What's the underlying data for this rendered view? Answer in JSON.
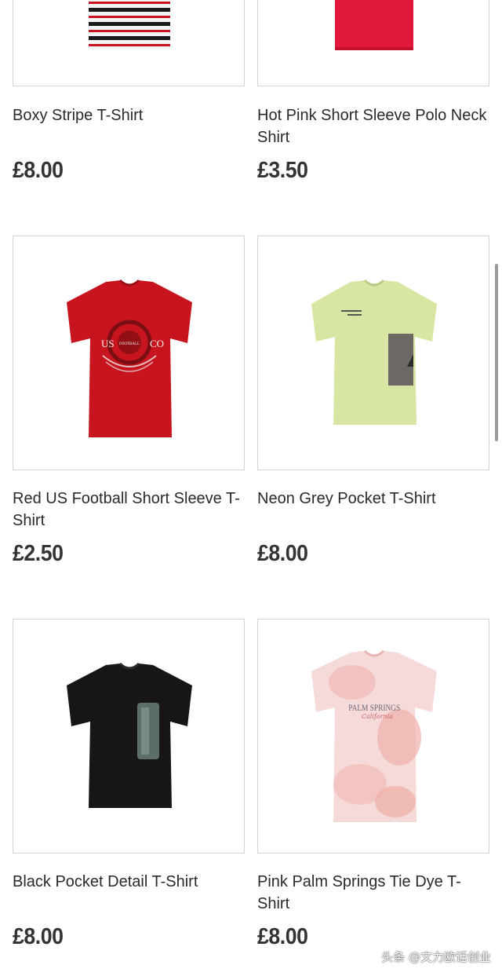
{
  "products": [
    {
      "name": "Boxy Stripe T-Shirt",
      "price": "£8.00"
    },
    {
      "name": "Hot Pink Short Sleeve Polo Neck Shirt",
      "price": "£3.50"
    },
    {
      "name": "Red US Football Short Sleeve T-Shirt",
      "price": "£2.50",
      "graphic": {
        "left": "US",
        "right": "CO",
        "center": "FOOTBALL"
      }
    },
    {
      "name": "Neon Grey Pocket T-Shirt",
      "price": "£8.00"
    },
    {
      "name": "Black Pocket Detail T-Shirt",
      "price": "£8.00"
    },
    {
      "name": "Pink Palm Springs Tie Dye T-Shirt",
      "price": "£8.00",
      "graphic": {
        "main": "PALM SPRINGS",
        "script": "California"
      }
    }
  ],
  "watermark": "头条 @文力欧话创业",
  "colors": {
    "red_shirt": "#c8141e",
    "neon_shirt": "#d7e6a3",
    "black_shirt": "#161616",
    "pink_shirt": "#f2c2c2",
    "polo_pink": "#e0183c"
  }
}
